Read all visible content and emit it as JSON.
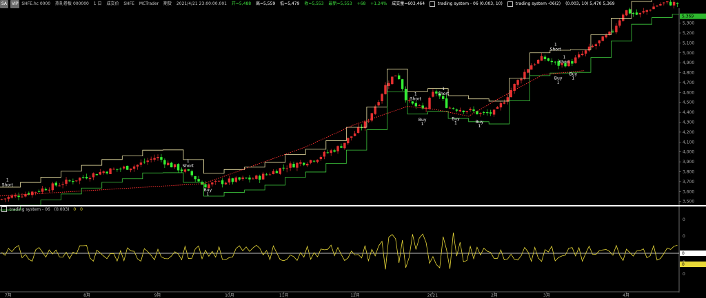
{
  "header": {
    "symbol_badge": "SA",
    "vip_badge": "VIP",
    "instrument": "SHFE.hc 0000",
    "contract": "热轧卷板 000000",
    "timeframe": "1 日",
    "trading_mode": "成交价",
    "exchange": "SHFE",
    "source": "MCTrader",
    "session": "期货",
    "datetime": "2021/4/21 23:00:00.001",
    "open": "开=5,488",
    "high": "高=5,559",
    "low": "低=5,479",
    "close": "收=5,553",
    "latest": "最新=5,553",
    "change": "+68",
    "change_pct": "+1.24%",
    "volume": "成交量=603,464",
    "study1": "trading system - 06 (0.003, 10)",
    "study2": "trading system -06(2)",
    "study2_params": "(0.003, 10) 5,470 5,369"
  },
  "subpanel": {
    "title": "trading system - 06",
    "params": "(0.003)",
    "val1": "0",
    "val2": "0",
    "right_labels": [
      "0",
      "0",
      "0",
      "0"
    ],
    "highlight_labels": [
      "0",
      "0"
    ]
  },
  "price_badge": "5,369",
  "colors": {
    "up": "#e53030",
    "down": "#33ee33",
    "band_upper": "#f0e6a8",
    "band_lower": "#3ec93e",
    "trend": "#ff3030",
    "osc": "#e8d838"
  },
  "chart_data": {
    "type": "candlestick",
    "y_ticks": [
      "5,300",
      "5,200",
      "5,100",
      "5,000",
      "4,900",
      "4,800",
      "4,700",
      "4,600",
      "4,500",
      "4,400",
      "4,300",
      "4,200",
      "4,100",
      "4,000",
      "3,900",
      "3,800",
      "3,700",
      "3,600",
      "3,500"
    ],
    "y_values": [
      5300,
      5200,
      5100,
      5000,
      4900,
      4800,
      4700,
      4600,
      4500,
      4400,
      4300,
      4200,
      4100,
      4000,
      3900,
      3800,
      3700,
      3600,
      3500
    ],
    "x_labels": [
      "7月",
      "8月",
      "9月",
      "10月",
      "11月",
      "12月",
      "2021",
      "2月",
      "3月",
      "4月"
    ],
    "x_positions_frac": [
      0.012,
      0.128,
      0.232,
      0.338,
      0.418,
      0.523,
      0.637,
      0.728,
      0.805,
      0.922
    ],
    "ylim": [
      3470,
      5450
    ],
    "signals": [
      {
        "label": "Short",
        "count": "1",
        "x_frac": 0.011,
        "price": 3640
      },
      {
        "label": "Short",
        "count": "1",
        "x_frac": 0.277,
        "price": 3830
      },
      {
        "label": "Buy",
        "count": "1",
        "x_frac": 0.306,
        "price": 3650
      },
      {
        "label": "Short",
        "count": "1",
        "x_frac": 0.612,
        "price": 4510
      },
      {
        "label": "Buy",
        "count": "1",
        "x_frac": 0.622,
        "price": 4360
      },
      {
        "label": "Short",
        "count": "1",
        "x_frac": 0.653,
        "price": 4560
      },
      {
        "label": "Buy",
        "count": "1",
        "x_frac": 0.671,
        "price": 4370
      },
      {
        "label": "Buy",
        "count": "1",
        "x_frac": 0.706,
        "price": 4340
      },
      {
        "label": "Short",
        "count": "1",
        "x_frac": 0.818,
        "price": 5010
      },
      {
        "label": "Short",
        "count": "1",
        "x_frac": 0.831,
        "price": 4880
      },
      {
        "label": "Buy",
        "count": "1",
        "x_frac": 0.822,
        "price": 4780
      },
      {
        "label": "Buy",
        "count": "1",
        "x_frac": 0.844,
        "price": 4820
      }
    ]
  }
}
